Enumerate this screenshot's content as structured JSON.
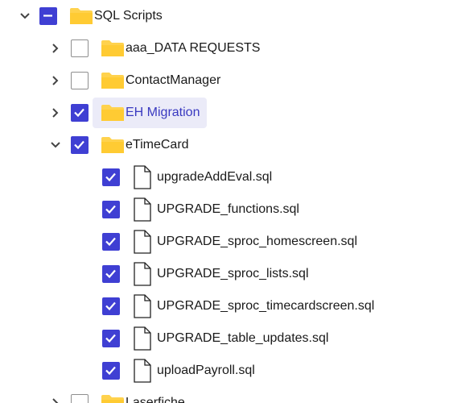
{
  "tree": {
    "root": {
      "label": "SQL Scripts",
      "expanded": true,
      "check_state": "partial",
      "icon": "folder-icon"
    },
    "folders": [
      {
        "label": "aaa_DATA REQUESTS",
        "expanded": false,
        "checked": false,
        "icon": "folder-icon"
      },
      {
        "label": "ContactManager",
        "expanded": false,
        "checked": false,
        "icon": "folder-icon"
      },
      {
        "label": "EH Migration",
        "expanded": false,
        "checked": true,
        "selected": true,
        "icon": "folder-icon"
      },
      {
        "label": "eTimeCard",
        "expanded": true,
        "checked": true,
        "icon": "folder-icon"
      }
    ],
    "etimecard_files": [
      {
        "label": "upgradeAddEval.sql",
        "checked": true,
        "icon": "file-icon"
      },
      {
        "label": "UPGRADE_functions.sql",
        "checked": true,
        "icon": "file-icon"
      },
      {
        "label": "UPGRADE_sproc_homescreen.sql",
        "checked": true,
        "icon": "file-icon"
      },
      {
        "label": "UPGRADE_sproc_lists.sql",
        "checked": true,
        "icon": "file-icon"
      },
      {
        "label": "UPGRADE_sproc_timecardscreen.sql",
        "checked": true,
        "icon": "file-icon"
      },
      {
        "label": "UPGRADE_table_updates.sql",
        "checked": true,
        "icon": "file-icon"
      },
      {
        "label": "uploadPayroll.sql",
        "checked": true,
        "icon": "file-icon"
      }
    ],
    "partial_folder": {
      "label": "Laserfiche",
      "expanded": false,
      "checked": false,
      "icon": "folder-icon"
    }
  },
  "colors": {
    "accent": "#3f3fd3",
    "folder": "#ffd24d",
    "selection_bg": "#ebebf8",
    "selection_text": "#3939c0"
  }
}
